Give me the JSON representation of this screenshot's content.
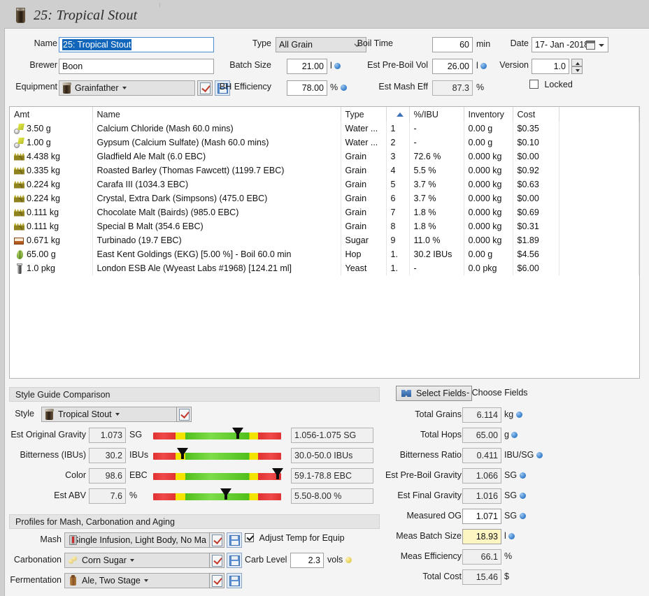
{
  "window": {
    "title": "25: Tropical Stout",
    "title_icon": "beer-glass-icon"
  },
  "recipe_header": {
    "name_label": "Name",
    "name_value": "25: Tropical Stout",
    "brewer_label": "Brewer",
    "brewer_value": "Boon",
    "equipment_label": "Equipment",
    "equipment_value": "Grainfather",
    "type_label": "Type",
    "type_value": "All Grain",
    "batch_size_label": "Batch Size",
    "batch_size_value": "21.00",
    "batch_size_unit": "l",
    "bh_efficiency_label": "BH Efficiency",
    "bh_efficiency_value": "78.00",
    "bh_efficiency_unit": "%",
    "boil_time_label": "Boil Time",
    "boil_time_value": "60",
    "boil_time_unit": "min",
    "est_preboil_vol_label": "Est Pre-Boil Vol",
    "est_preboil_vol_value": "26.00",
    "est_preboil_vol_unit": "l",
    "est_mash_eff_label": "Est Mash Eff",
    "est_mash_eff_value": "87.3",
    "est_mash_eff_unit": "%",
    "date_label": "Date",
    "date_value": "17- Jan -2018",
    "version_label": "Version",
    "version_value": "1.0",
    "locked_label": "Locked",
    "locked_checked": false
  },
  "ingredients": {
    "columns": [
      "Amt",
      "Name",
      "Type",
      "",
      "%/IBU",
      "Inventory",
      "Cost"
    ],
    "sort_column_index": 3,
    "rows": [
      {
        "icon": "water-icon",
        "amt": "3.50 g",
        "name": "Calcium Chloride (Mash 60.0 mins)",
        "type": "Water ...",
        "idx": "1",
        "pct": "-",
        "inventory": "0.00 g",
        "cost": "$0.35"
      },
      {
        "icon": "water-icon",
        "amt": "1.00 g",
        "name": "Gypsum (Calcium Sulfate) (Mash 60.0 mins)",
        "type": "Water ...",
        "idx": "2",
        "pct": "-",
        "inventory": "0.00 g",
        "cost": "$0.10"
      },
      {
        "icon": "grain-icon",
        "amt": "4.438 kg",
        "name": "Gladfield Ale Malt (6.0 EBC)",
        "type": "Grain",
        "idx": "3",
        "pct": "72.6 %",
        "inventory": "0.000 kg",
        "cost": "$0.00"
      },
      {
        "icon": "grain-icon",
        "amt": "0.335 kg",
        "name": "Roasted Barley (Thomas Fawcett) (1199.7 EBC)",
        "type": "Grain",
        "idx": "4",
        "pct": "5.5 %",
        "inventory": "0.000 kg",
        "cost": "$0.92"
      },
      {
        "icon": "grain-icon",
        "amt": "0.224 kg",
        "name": "Carafa III (1034.3 EBC)",
        "type": "Grain",
        "idx": "5",
        "pct": "3.7 %",
        "inventory": "0.000 kg",
        "cost": "$0.63"
      },
      {
        "icon": "grain-icon",
        "amt": "0.224 kg",
        "name": "Crystal, Extra Dark (Simpsons) (475.0 EBC)",
        "type": "Grain",
        "idx": "6",
        "pct": "3.7 %",
        "inventory": "0.000 kg",
        "cost": "$0.00"
      },
      {
        "icon": "grain-icon",
        "amt": "0.111 kg",
        "name": "Chocolate Malt (Bairds) (985.0 EBC)",
        "type": "Grain",
        "idx": "7",
        "pct": "1.8 %",
        "inventory": "0.000 kg",
        "cost": "$0.69"
      },
      {
        "icon": "grain-icon",
        "amt": "0.111 kg",
        "name": "Special B Malt (354.6 EBC)",
        "type": "Grain",
        "idx": "8",
        "pct": "1.8 %",
        "inventory": "0.000 kg",
        "cost": "$0.31"
      },
      {
        "icon": "sugar-icon",
        "amt": "0.671 kg",
        "name": "Turbinado (19.7 EBC)",
        "type": "Sugar",
        "idx": "9",
        "pct": "11.0 %",
        "inventory": "0.000 kg",
        "cost": "$1.89"
      },
      {
        "icon": "hop-icon",
        "amt": "65.00 g",
        "name": "East Kent Goldings (EKG) [5.00 %] - Boil 60.0 min",
        "type": "Hop",
        "idx": "1.",
        "pct": "30.2 IBUs",
        "inventory": "0.00 g",
        "cost": "$4.56"
      },
      {
        "icon": "yeast-icon",
        "amt": "1.0 pkg",
        "name": "London ESB Ale (Wyeast Labs #1968) [124.21 ml]",
        "type": "Yeast",
        "idx": "1.",
        "pct": "-",
        "inventory": "0.0 pkg",
        "cost": "$6.00"
      }
    ]
  },
  "style_guide": {
    "section_title": "Style Guide Comparison",
    "style_label": "Style",
    "style_value": "Tropical Stout",
    "metrics": [
      {
        "label": "Est Original Gravity",
        "value": "1.073",
        "unit": "SG",
        "range": "1.056-1.075 SG",
        "marker_pct": 66
      },
      {
        "label": "Bitterness (IBUs)",
        "value": "30.2",
        "unit": "IBUs",
        "range": "30.0-50.0 IBUs",
        "marker_pct": 23
      },
      {
        "label": "Color",
        "value": "98.6",
        "unit": "EBC",
        "range": "59.1-78.8 EBC",
        "marker_pct": 97
      },
      {
        "label": "Est ABV",
        "value": "7.6",
        "unit": "%",
        "range": "5.50-8.00 %",
        "marker_pct": 57
      }
    ]
  },
  "profiles": {
    "section_title": "Profiles for Mash, Carbonation and Aging",
    "mash_label": "Mash",
    "mash_value": "Single Infusion, Light Body, No Ma",
    "adjust_temp_label": "Adjust Temp for Equip",
    "adjust_temp_checked": true,
    "carbonation_label": "Carbonation",
    "carbonation_value": "Corn Sugar",
    "carb_level_label": "Carb Level",
    "carb_level_value": "2.3",
    "carb_level_unit": "vols",
    "fermentation_label": "Fermentation",
    "fermentation_value": "Ale, Two Stage"
  },
  "fields_panel": {
    "select_fields_button": "Select Fields",
    "choose_fields_hint": "- Choose Fields",
    "rows": [
      {
        "label": "Total Grains",
        "value": "6.114",
        "unit": "kg",
        "dot": "blue",
        "style": "readonly"
      },
      {
        "label": "Total Hops",
        "value": "65.00",
        "unit": "g",
        "dot": "blue",
        "style": "readonly"
      },
      {
        "label": "Bitterness Ratio",
        "value": "0.411",
        "unit": "IBU/SG",
        "dot": "blue",
        "style": "readonly"
      },
      {
        "label": "Est Pre-Boil Gravity",
        "value": "1.066",
        "unit": "SG",
        "dot": "blue",
        "style": "readonly"
      },
      {
        "label": "Est Final Gravity",
        "value": "1.016",
        "unit": "SG",
        "dot": "blue",
        "style": "readonly"
      },
      {
        "label": "Measured OG",
        "value": "1.071",
        "unit": "SG",
        "dot": "blue",
        "style": "white"
      },
      {
        "label": "Meas Batch Size",
        "value": "18.93",
        "unit": "l",
        "dot": "blue",
        "style": "highlight"
      },
      {
        "label": "Meas Efficiency",
        "value": "66.1",
        "unit": "%",
        "dot": "none",
        "style": "readonly"
      },
      {
        "label": "Total Cost",
        "value": "15.46",
        "unit": "$",
        "dot": "none",
        "style": "readonly"
      }
    ]
  },
  "colors": {
    "accent_blue": "#3f86d0",
    "selection_blue": "#1166bb",
    "highlight_yellow": "#fdf5c2",
    "bar_red": "#e03131",
    "bar_yellow": "#f2e400",
    "bar_green": "#4fbf1b"
  }
}
